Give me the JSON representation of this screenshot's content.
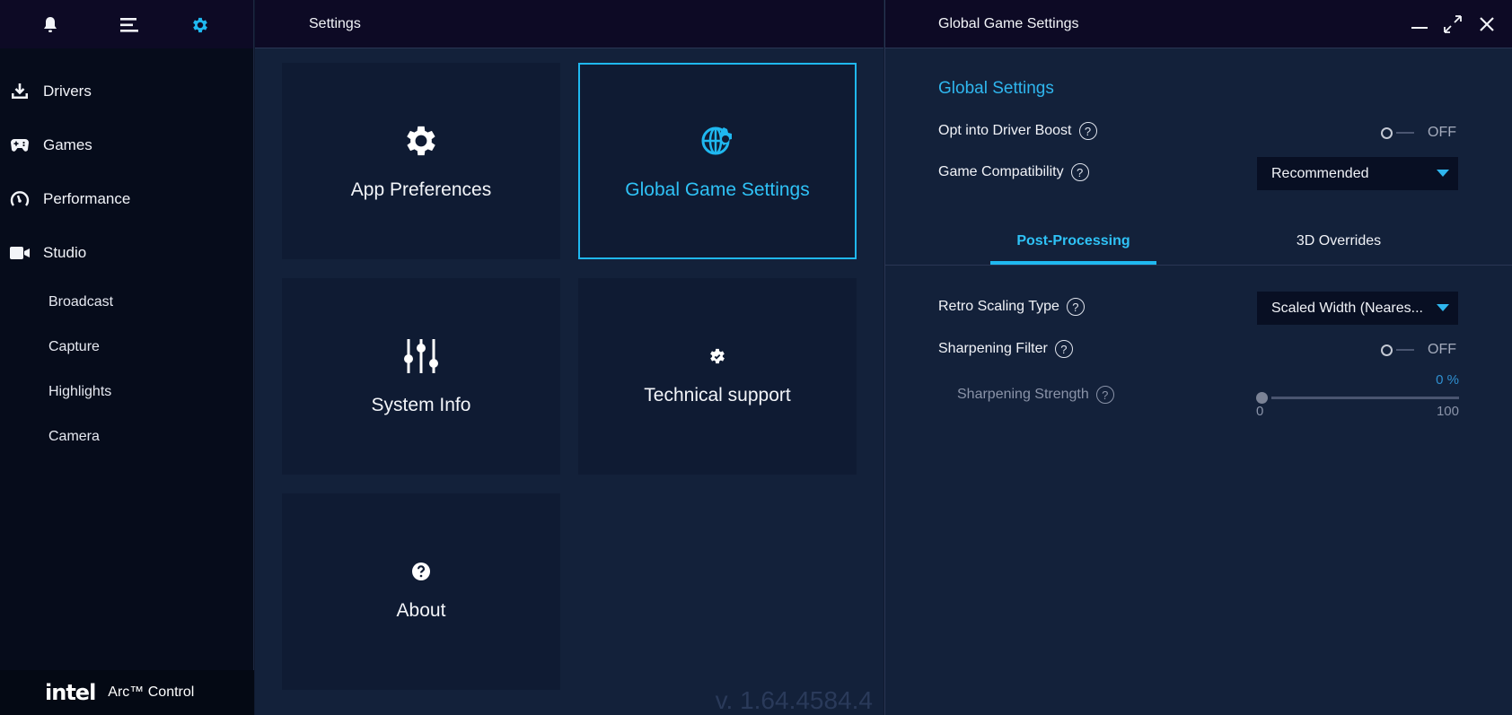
{
  "sidebar": {
    "top_icons": [
      "bell-icon",
      "menu-icon",
      "gear-icon"
    ],
    "items": [
      {
        "label": "Drivers",
        "icon": "download-icon"
      },
      {
        "label": "Games",
        "icon": "gamepad-icon"
      },
      {
        "label": "Performance",
        "icon": "gauge-icon"
      },
      {
        "label": "Studio",
        "icon": "camera-icon"
      }
    ],
    "sub_items": [
      "Broadcast",
      "Capture",
      "Highlights",
      "Camera"
    ],
    "brand": {
      "logo": "intel",
      "name": "Arc™ Control"
    }
  },
  "settings_panel": {
    "title": "Settings",
    "cards": [
      {
        "label": "App Preferences",
        "icon": "gear-icon"
      },
      {
        "label": "Global Game Settings",
        "icon": "globe-gear-icon",
        "selected": true
      },
      {
        "label": "System Info",
        "icon": "sliders-icon"
      },
      {
        "label": "Technical support",
        "icon": "support-gear-icon"
      },
      {
        "label": "About",
        "icon": "question-icon"
      }
    ],
    "version": "v. 1.64.4584.4"
  },
  "global_panel": {
    "title": "Global Game Settings",
    "section_title": "Global Settings",
    "driver_boost": {
      "label": "Opt into Driver Boost",
      "state": "OFF"
    },
    "game_compat": {
      "label": "Game Compatibility",
      "value": "Recommended"
    },
    "tabs": [
      "Post-Processing",
      "3D Overrides"
    ],
    "active_tab": "Post-Processing",
    "retro_scaling": {
      "label": "Retro Scaling Type",
      "value": "Scaled Width (Neares..."
    },
    "sharpening_filter": {
      "label": "Sharpening Filter",
      "state": "OFF"
    },
    "sharpening_strength": {
      "label": "Sharpening Strength",
      "value_text": "0 %",
      "value": 0,
      "min": "0",
      "max": "100"
    }
  },
  "colors": {
    "accent": "#1fb8f0",
    "background": "#13213a",
    "sidebar": "#060c1b"
  }
}
